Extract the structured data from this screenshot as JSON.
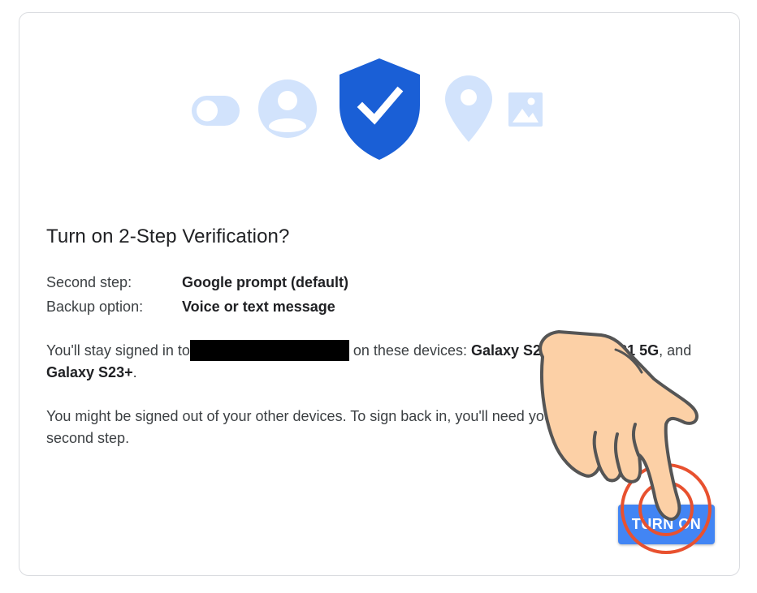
{
  "dialog": {
    "title": "Turn on 2-Step Verification?",
    "second_step_label": "Second step:",
    "second_step_value": "Google prompt (default)",
    "backup_label": "Backup option:",
    "backup_value": "Voice or text message",
    "signed_in_prefix": "You'll stay signed in to",
    "signed_in_mid": " on these devices: ",
    "device_1": "Galaxy S20",
    "device_sep": ", ",
    "device_2": "Galaxy S21 5G",
    "device_and": ", and ",
    "device_3": "Galaxy S23+",
    "period": ".",
    "signout_note": "You might be signed out of your other devices. To sign back in, you'll need your password and second step.",
    "turn_on_button": "TURN ON"
  },
  "icons": [
    "toggle-icon",
    "account-icon",
    "shield-check-icon",
    "location-pin-icon",
    "image-icon",
    "pointing-hand-icon"
  ],
  "colors": {
    "accent": "#4285f4",
    "shield": "#1a5fd6",
    "icon_light": "#d2e3fc",
    "click_ring": "#e8512f",
    "hand_fill": "#fcd0a6"
  }
}
